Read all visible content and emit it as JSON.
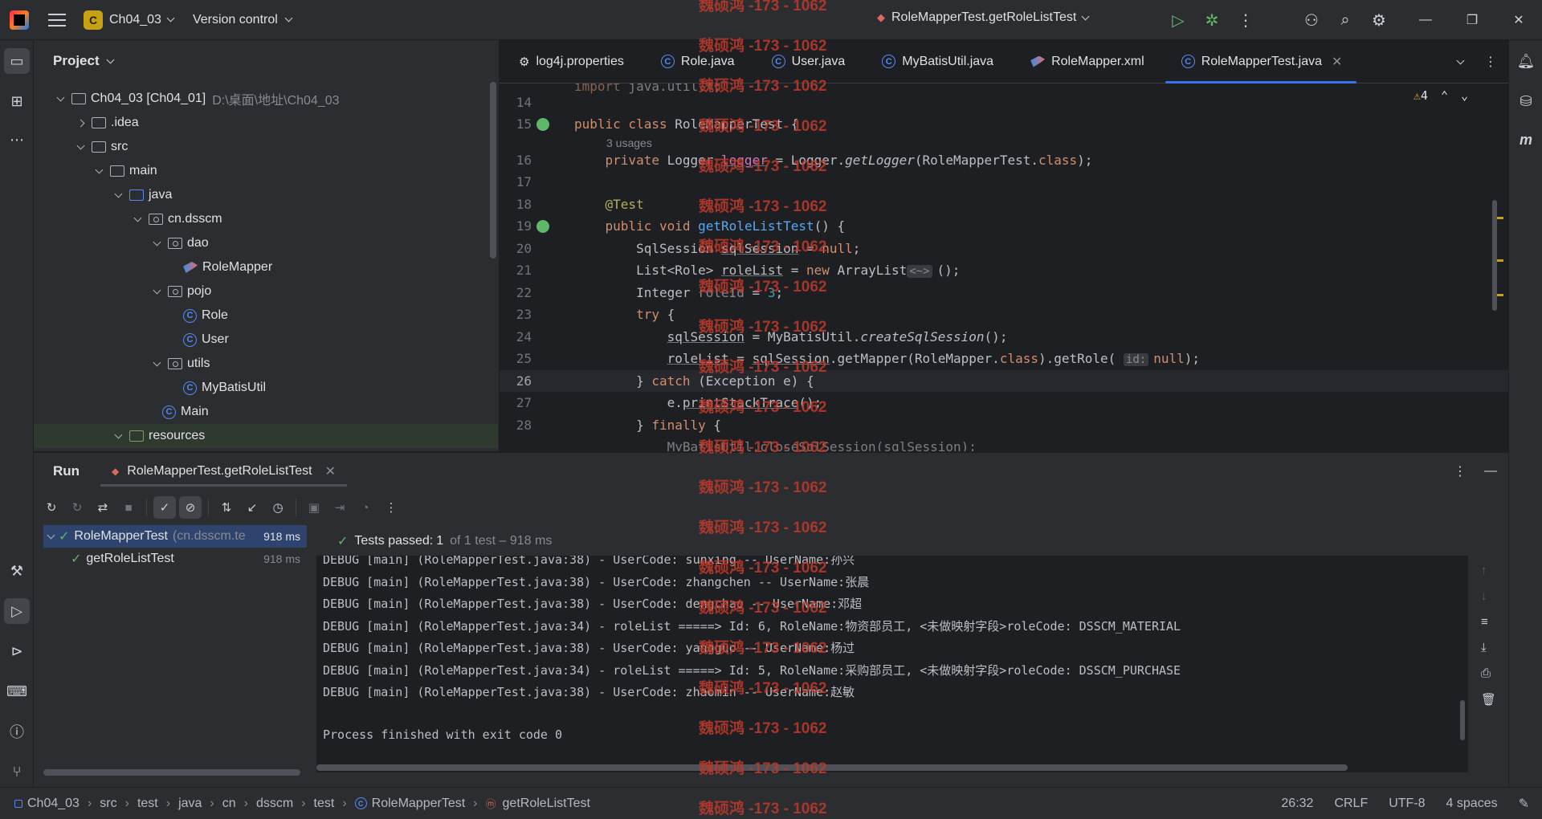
{
  "titlebar": {
    "project_badge": "C",
    "project_name": "Ch04_03",
    "version_control": "Version control",
    "run_config": "RoleMapperTest.getRoleListTest"
  },
  "project_panel": {
    "title": "Project",
    "tree": [
      {
        "label": "Ch04_03 [Ch04_01]",
        "extra": "D:\\桌面\\地址\\Ch04_03"
      },
      {
        "label": ".idea"
      },
      {
        "label": "src"
      },
      {
        "label": "main"
      },
      {
        "label": "java"
      },
      {
        "label": "cn.dsscm"
      },
      {
        "label": "dao"
      },
      {
        "label": "RoleMapper"
      },
      {
        "label": "pojo"
      },
      {
        "label": "Role"
      },
      {
        "label": "User"
      },
      {
        "label": "utils"
      },
      {
        "label": "MyBatisUtil"
      },
      {
        "label": "Main"
      },
      {
        "label": "resources"
      }
    ]
  },
  "editor": {
    "tabs": [
      {
        "label": "log4j.properties",
        "icon": "gear-icon"
      },
      {
        "label": "Role.java",
        "icon": "class-icon"
      },
      {
        "label": "User.java",
        "icon": "class-icon"
      },
      {
        "label": "MyBatisUtil.java",
        "icon": "class-icon"
      },
      {
        "label": "RoleMapper.xml",
        "icon": "mybatis-icon"
      },
      {
        "label": "RoleMapperTest.java",
        "icon": "class-icon",
        "active": true
      }
    ],
    "warnings_count": "4",
    "usages_hint": "3 usages",
    "param_hint": "id:",
    "line_numbers": [
      "14",
      "15",
      "16",
      "17",
      "18",
      "19",
      "20",
      "21",
      "22",
      "23",
      "24",
      "25",
      "26",
      "27",
      "28"
    ],
    "current_line": "26"
  },
  "run_panel": {
    "title": "Run",
    "tab_label": "RoleMapperTest.getRoleListTest",
    "tests": [
      {
        "name": "RoleMapperTest",
        "pkg": "(cn.dsscm.te",
        "time": "918 ms"
      },
      {
        "name": "getRoleListTest",
        "time": "918 ms"
      }
    ],
    "status_prefix": "Tests passed:",
    "status_count": "1",
    "status_suffix": "of 1 test – 918 ms",
    "console": [
      "DEBUG [main] (RoleMapperTest.java:38) - UserCode: sunxing -- UserName:孙兴",
      "DEBUG [main] (RoleMapperTest.java:38) - UserCode: zhangchen -- UserName:张晨",
      "DEBUG [main] (RoleMapperTest.java:38) - UserCode: dengchao -- UserName:邓超",
      "DEBUG [main] (RoleMapperTest.java:34) - roleList =====> Id: 6, RoleName:物资部员工, <未做映射字段>roleCode: DSSCM_MATERIAL",
      "DEBUG [main] (RoleMapperTest.java:38) - UserCode: yangguo -- UserName:杨过",
      "DEBUG [main] (RoleMapperTest.java:34) - roleList =====> Id: 5, RoleName:采购部员工, <未做映射字段>roleCode: DSSCM_PURCHASE",
      "DEBUG [main] (RoleMapperTest.java:38) - UserCode: zhaomin -- UserName:赵敏",
      "",
      "Process finished with exit code 0"
    ]
  },
  "statusbar": {
    "breadcrumbs": [
      "Ch04_03",
      "src",
      "test",
      "java",
      "cn",
      "dsscm",
      "test",
      "RoleMapperTest",
      "getRoleListTest"
    ],
    "position": "26:32",
    "line_sep": "CRLF",
    "encoding": "UTF-8",
    "indent": "4 spaces"
  },
  "watermark": "魏硕鸿 -173 - 1062",
  "colors": {
    "accent": "#3574f0",
    "pass": "#5fb86a",
    "warning": "#e0a03b",
    "watermark": "#c0392b"
  }
}
